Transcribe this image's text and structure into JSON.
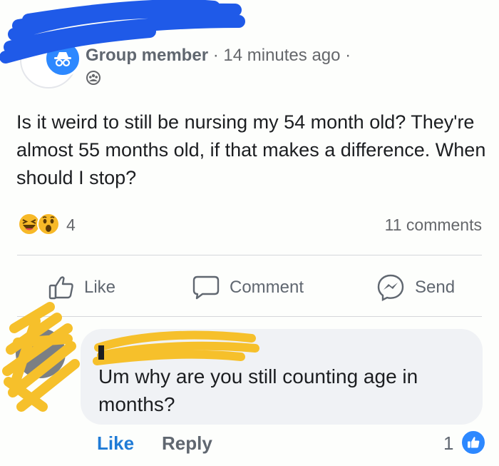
{
  "post": {
    "author_role": "Group member",
    "separator": "·",
    "time": "14 minutes ago",
    "trailing_dot": "·",
    "privacy_icon": "group-icon",
    "text": "Is it weird to still be nursing my 54 month old? They're almost 55 months old, if that makes a difference. When should I stop?",
    "reactions": {
      "icons": [
        "haha-icon",
        "wow-icon"
      ],
      "count": "4"
    },
    "comments_count": "11 comments"
  },
  "actions": {
    "like": "Like",
    "comment": "Comment",
    "send": "Send"
  },
  "comment": {
    "text": "Um why are you still counting age in months?",
    "like_link": "Like",
    "reply_link": "Reply",
    "likes_count": "1"
  },
  "colors": {
    "accent_blue": "#2d88ff",
    "link_blue": "#1f7bd6",
    "redaction_blue": "#1f5ae8",
    "redaction_yellow": "#f6c02b",
    "muted_text": "#65676b",
    "bubble_bg": "#f0f2f5"
  }
}
